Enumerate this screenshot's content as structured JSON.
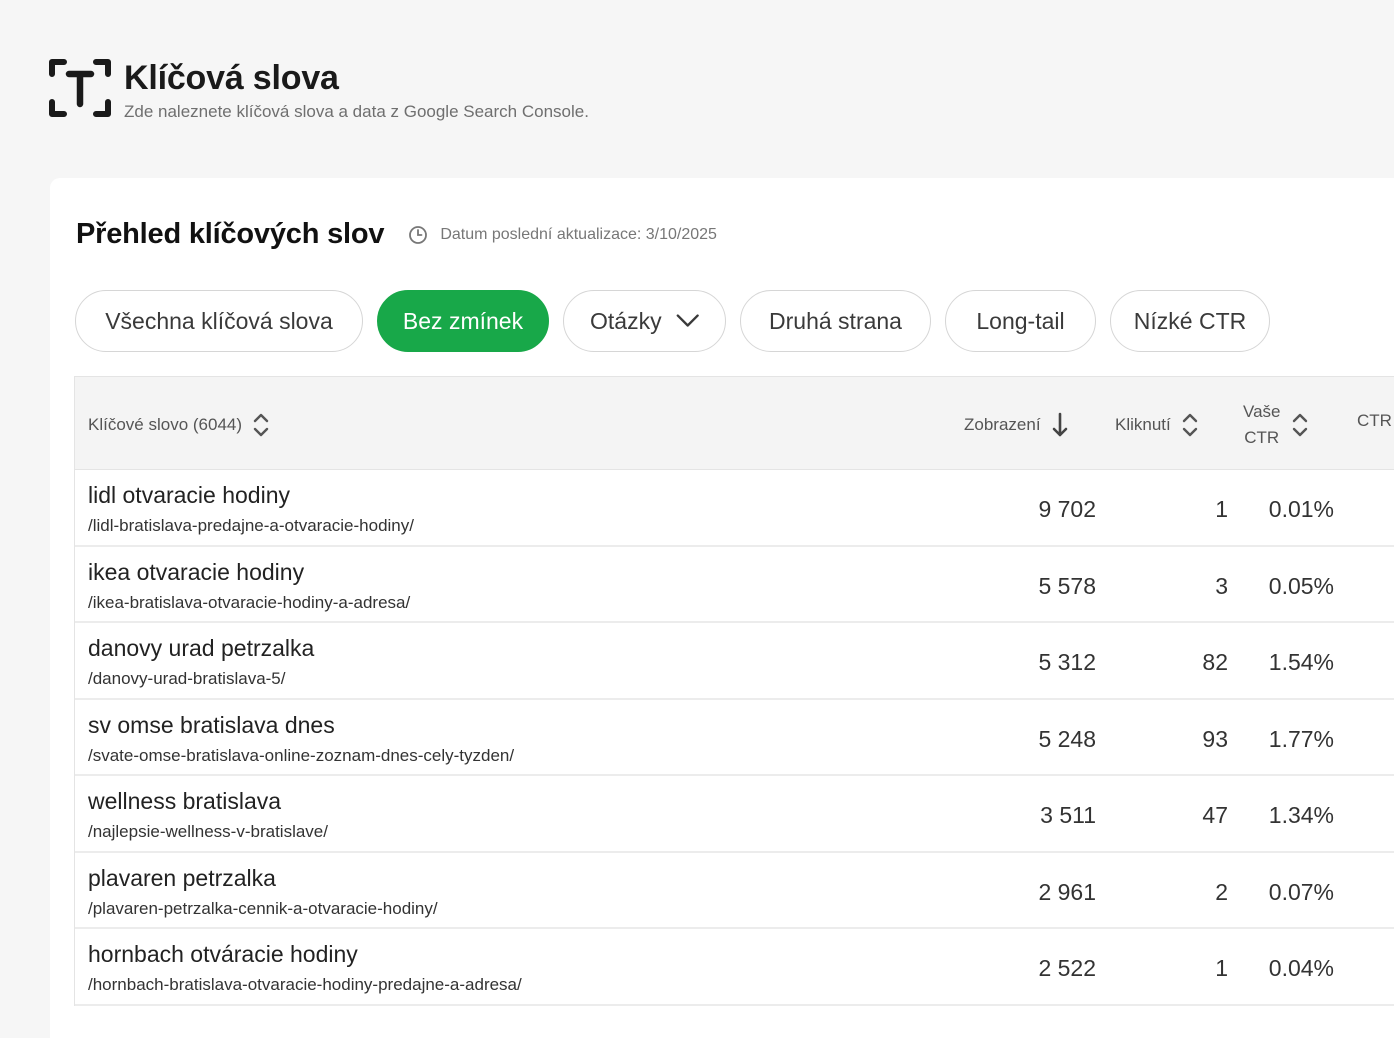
{
  "header": {
    "title": "Klíčová slova",
    "subtitle": "Zde naleznete klíčová slova a data z Google Search Console.",
    "icon": "text-t-icon"
  },
  "overview": {
    "title": "Přehled klíčových slov",
    "update_label": "Datum poslední aktualizace: 3/10/2025"
  },
  "filters": [
    {
      "label": "Všechna klíčová slova",
      "active": false
    },
    {
      "label": "Bez zmínek",
      "active": true
    },
    {
      "label": "Otázky",
      "active": false,
      "dropdown": true
    },
    {
      "label": "Druhá strana",
      "active": false
    },
    {
      "label": "Long-tail",
      "active": false
    },
    {
      "label": "Nízké CTR",
      "active": false
    }
  ],
  "table": {
    "columns": {
      "keyword": "Klíčové slovo (6044)",
      "impressions": "Zobrazení",
      "clicks": "Kliknutí",
      "your_ctr_line1": "Vaše",
      "your_ctr_line2": "CTR",
      "ctr": "CTR"
    },
    "rows": [
      {
        "keyword": "lidl otvaracie hodiny",
        "url": "/lidl-bratislava-predajne-a-otvaracie-hodiny/",
        "impressions": "9 702",
        "clicks": "1",
        "ctr": "0.01%"
      },
      {
        "keyword": "ikea otvaracie hodiny",
        "url": "/ikea-bratislava-otvaracie-hodiny-a-adresa/",
        "impressions": "5 578",
        "clicks": "3",
        "ctr": "0.05%"
      },
      {
        "keyword": "danovy urad petrzalka",
        "url": "/danovy-urad-bratislava-5/",
        "impressions": "5 312",
        "clicks": "82",
        "ctr": "1.54%"
      },
      {
        "keyword": "sv omse bratislava dnes",
        "url": "/svate-omse-bratislava-online-zoznam-dnes-cely-tyzden/",
        "impressions": "5 248",
        "clicks": "93",
        "ctr": "1.77%"
      },
      {
        "keyword": "wellness bratislava",
        "url": "/najlepsie-wellness-v-bratislave/",
        "impressions": "3 511",
        "clicks": "47",
        "ctr": "1.34%"
      },
      {
        "keyword": "plavaren petrzalka",
        "url": "/plavaren-petrzalka-cennik-a-otvaracie-hodiny/",
        "impressions": "2 961",
        "clicks": "2",
        "ctr": "0.07%"
      },
      {
        "keyword": "hornbach otváracie hodiny",
        "url": "/hornbach-bratislava-otvaracie-hodiny-predajne-a-adresa/",
        "impressions": "2 522",
        "clicks": "1",
        "ctr": "0.04%"
      }
    ]
  },
  "colors": {
    "accent": "#18a849"
  }
}
